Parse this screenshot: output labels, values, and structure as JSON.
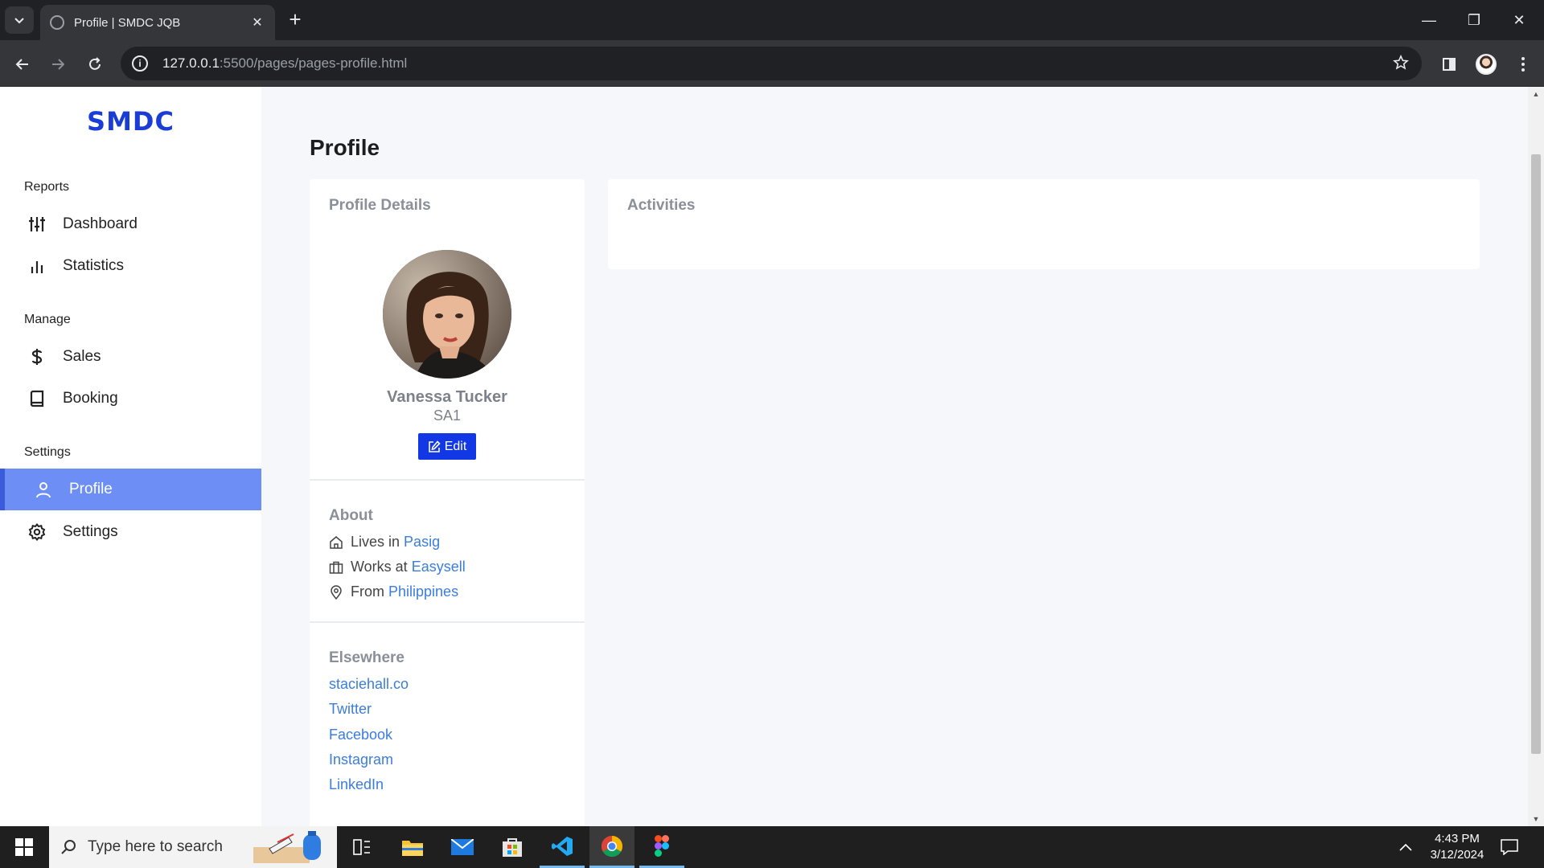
{
  "browser": {
    "tab_title": "Profile | SMDC JQB",
    "url_host": "127.0.0.1",
    "url_path": ":5500/pages/pages-profile.html"
  },
  "sidebar": {
    "brand": "SMDC",
    "sections": {
      "reports": "Reports",
      "manage": "Manage",
      "settings": "Settings"
    },
    "items": {
      "dashboard": "Dashboard",
      "statistics": "Statistics",
      "sales": "Sales",
      "booking": "Booking",
      "profile": "Profile",
      "settings": "Settings"
    },
    "active_item": "Profile",
    "accent_color": "#6c8ef5"
  },
  "main": {
    "page_title": "Profile",
    "profile_card": {
      "heading": "Profile Details",
      "name": "Vanessa Tucker",
      "role": "SA1",
      "edit_label": "Edit"
    },
    "about": {
      "heading": "About",
      "lives_prefix": "Lives in",
      "lives_value": "Pasig",
      "works_prefix": "Works at",
      "works_value": "Easysell",
      "from_prefix": "From",
      "from_value": "Philippines"
    },
    "elsewhere": {
      "heading": "Elsewhere",
      "links": [
        "staciehall.co",
        "Twitter",
        "Facebook",
        "Instagram",
        "LinkedIn"
      ]
    },
    "activities": {
      "heading": "Activities"
    }
  },
  "taskbar": {
    "search_placeholder": "Type here to search",
    "time": "4:43 PM",
    "date": "3/12/2024"
  }
}
